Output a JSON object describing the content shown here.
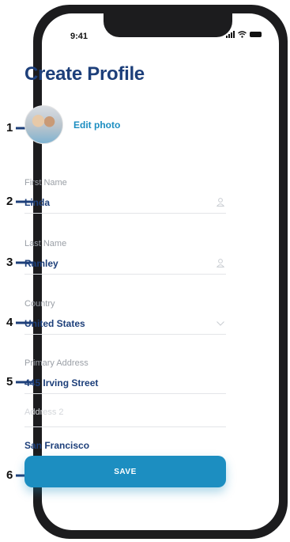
{
  "status_bar": {
    "time": "9:41"
  },
  "page": {
    "title": "Create Profile"
  },
  "profile": {
    "edit_photo_label": "Edit photo"
  },
  "form": {
    "first_name": {
      "label": "First Name",
      "value": "Linda",
      "icon": "person-icon"
    },
    "last_name": {
      "label": "Last Name",
      "value": "Ramley",
      "icon": "person-icon"
    },
    "country": {
      "label": "Country",
      "value": "United States",
      "icon": "chevron-down-icon"
    },
    "primary_address": {
      "label": "Primary Address",
      "value": "445 Irving Street"
    },
    "address2": {
      "placeholder": "Address 2"
    },
    "city": {
      "value": "San Francisco"
    }
  },
  "save_button": {
    "label": "SAVE"
  },
  "callouts": [
    "1",
    "2",
    "3",
    "4",
    "5",
    "6"
  ],
  "colors": {
    "title": "#1d3f7a",
    "accent": "#1c8ec1",
    "label": "#9a9fa6",
    "divider": "#e3e5e8"
  }
}
